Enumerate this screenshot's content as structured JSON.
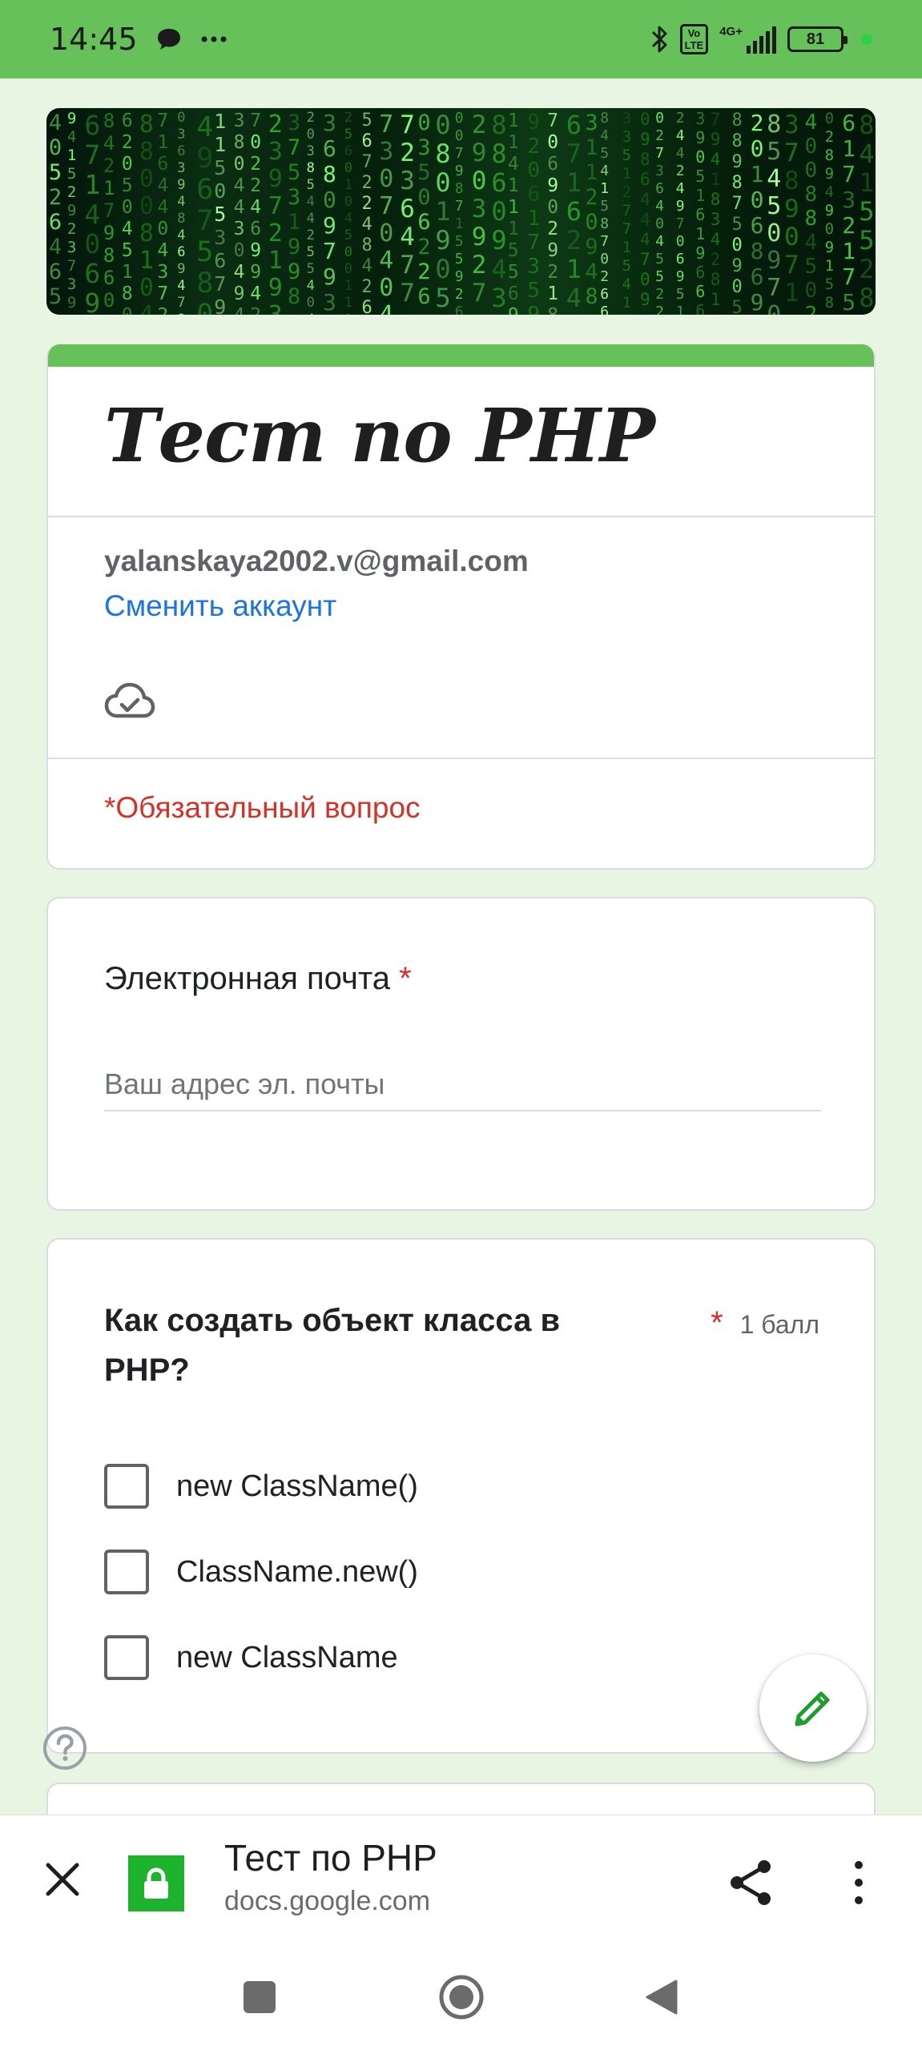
{
  "status_bar": {
    "time": "14:45",
    "battery": "81",
    "network": "4G+",
    "volte": "Vo LTE",
    "icons": [
      "message-icon",
      "more-dots-icon",
      "bluetooth-icon",
      "volte-icon",
      "signal-icon",
      "battery-icon"
    ]
  },
  "form": {
    "title": "Тест по PHP",
    "account_email": "yalanskaya2002.v@gmail.com",
    "switch_account": "Сменить аккаунт",
    "required_note": "*Обязательный вопрос"
  },
  "email_question": {
    "label": "Электронная почта",
    "required_mark": "*",
    "placeholder": "Ваш адрес эл. почты",
    "value": ""
  },
  "question1": {
    "title": "Как создать объект класса в PHP?",
    "required_mark": "*",
    "points": "1 балл",
    "options": [
      {
        "label": "new ClassName()",
        "checked": false
      },
      {
        "label": "ClassName.new()",
        "checked": false
      },
      {
        "label": "new ClassName",
        "checked": false
      }
    ]
  },
  "browser": {
    "page_title": "Тест по PHP",
    "domain": "docs.google.com"
  },
  "colors": {
    "accent": "#66c15a",
    "background": "#e8f5e3",
    "link": "#1a73e8",
    "required": "#d93025",
    "lock": "#1db32c"
  }
}
